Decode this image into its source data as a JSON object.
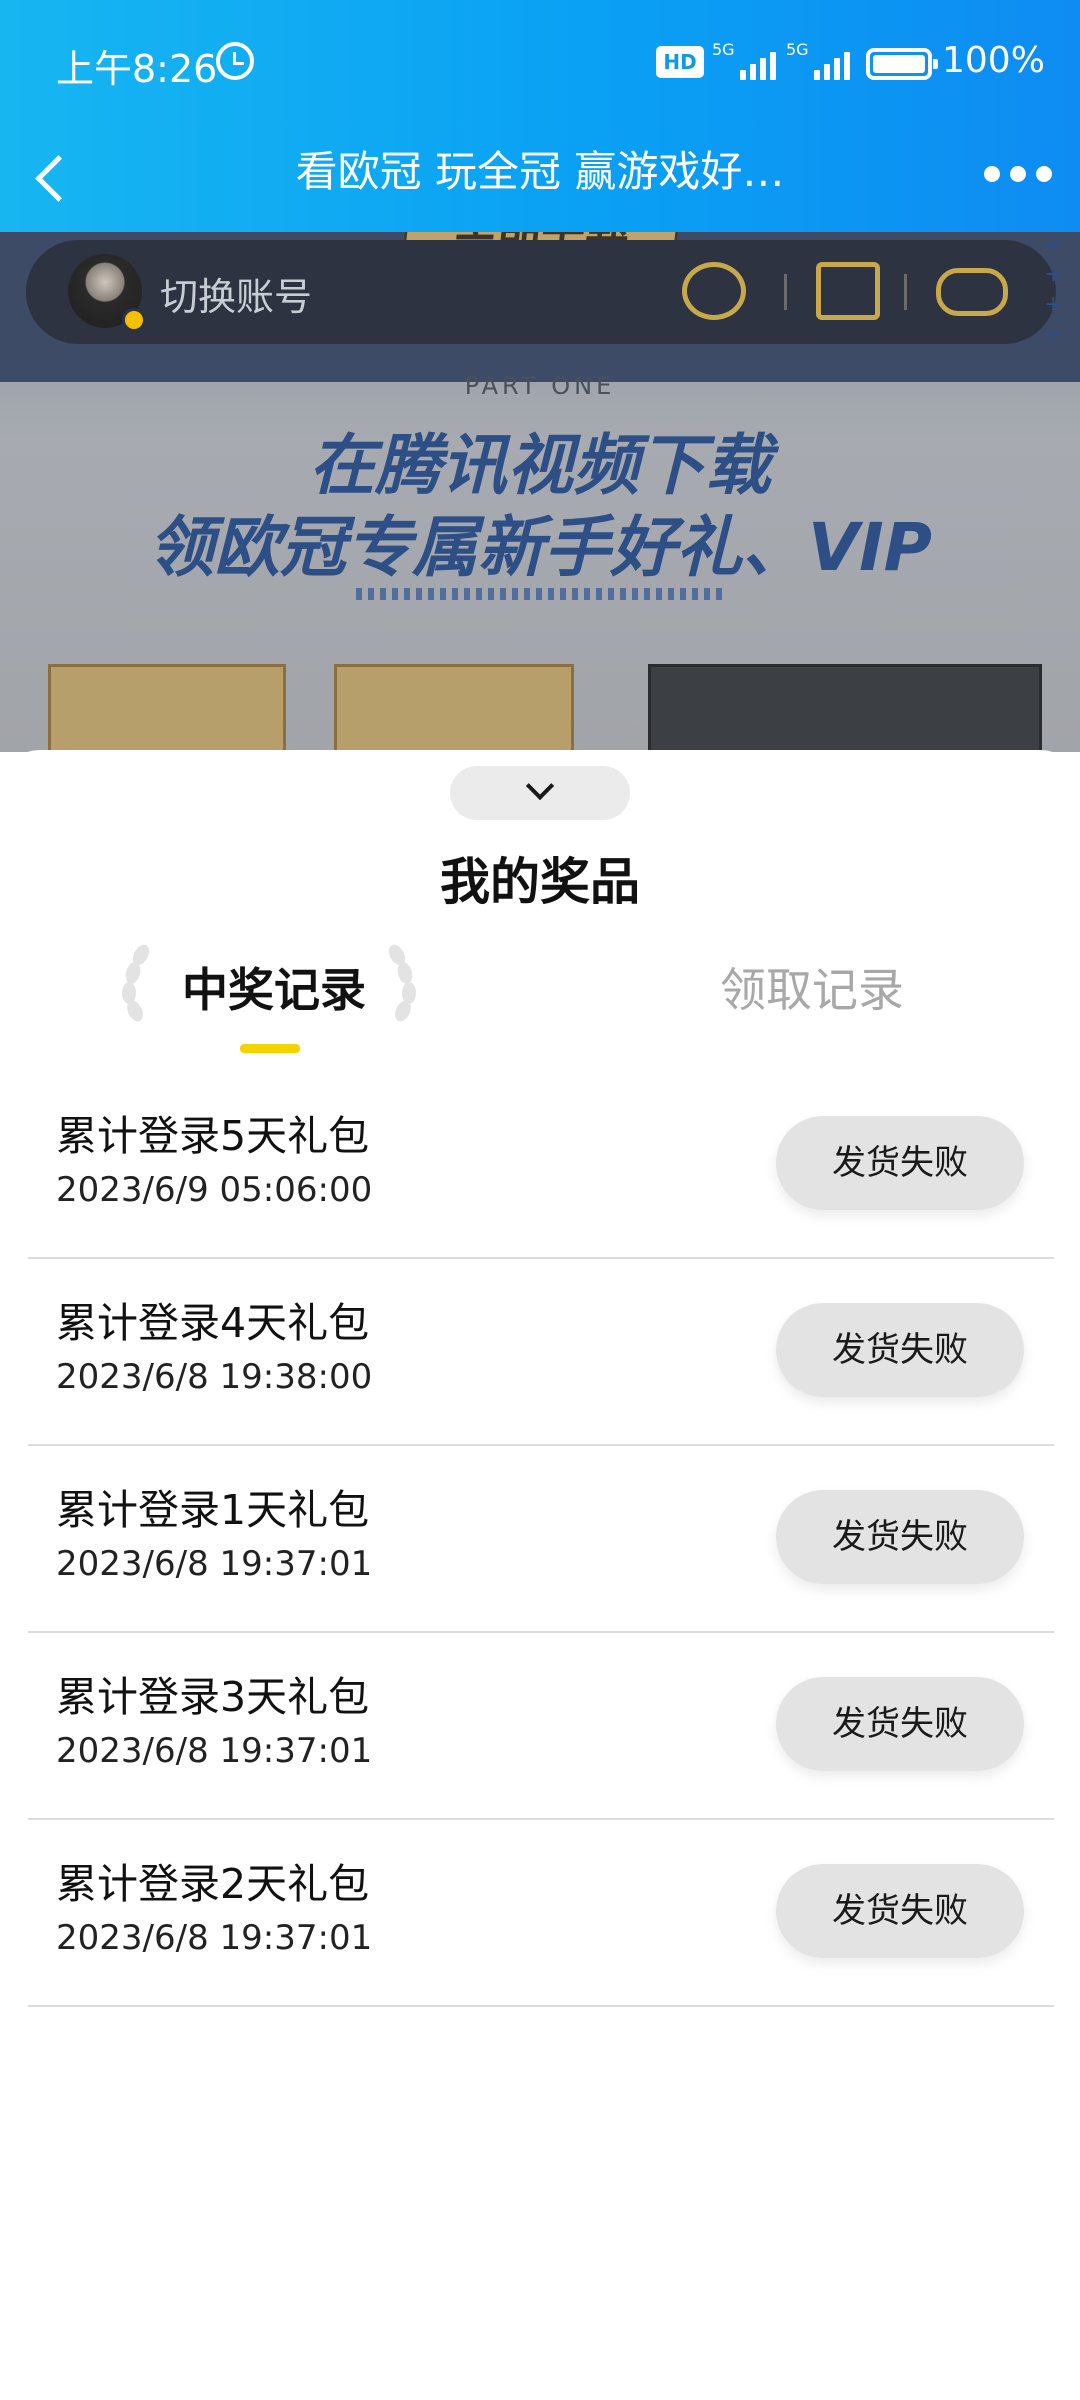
{
  "status_bar": {
    "time": "上午8:26",
    "hd_label": "HD",
    "signal1_gen": "5G",
    "signal2_gen": "5G",
    "battery": "100%",
    "icons": [
      "alarm-icon",
      "hd-icon",
      "signal-icon",
      "battery-icon"
    ]
  },
  "nav": {
    "title": "看欧冠 玩全冠 赢游戏好…",
    "back_icon": "back-arrow-icon",
    "more_icon": "more-dots-icon",
    "bg_color": "#0aa0f4"
  },
  "background_page": {
    "switch_account": "切换账号",
    "download_badge": "立即下载",
    "part_label": "PART ONE",
    "headline_1": "在腾讯视频下载",
    "headline_2": "领欧冠专属新手好礼、VIP",
    "icons": [
      "wechat-icon",
      "gift-icon",
      "gamepad-icon"
    ]
  },
  "sheet": {
    "title": "我的奖品",
    "tabs": [
      {
        "label": "中奖记录",
        "active": true
      },
      {
        "label": "领取记录",
        "active": false
      }
    ],
    "accent_color": "#f5d200",
    "records": [
      {
        "name": "累计登录5天礼包",
        "date": "2023/6/9 05:06:00",
        "status": "发货失败"
      },
      {
        "name": "累计登录4天礼包",
        "date": "2023/6/8 19:38:00",
        "status": "发货失败"
      },
      {
        "name": "累计登录1天礼包",
        "date": "2023/6/8 19:37:01",
        "status": "发货失败"
      },
      {
        "name": "累计登录3天礼包",
        "date": "2023/6/8 19:37:01",
        "status": "发货失败"
      },
      {
        "name": "累计登录2天礼包",
        "date": "2023/6/8 19:37:01",
        "status": "发货失败"
      }
    ]
  }
}
